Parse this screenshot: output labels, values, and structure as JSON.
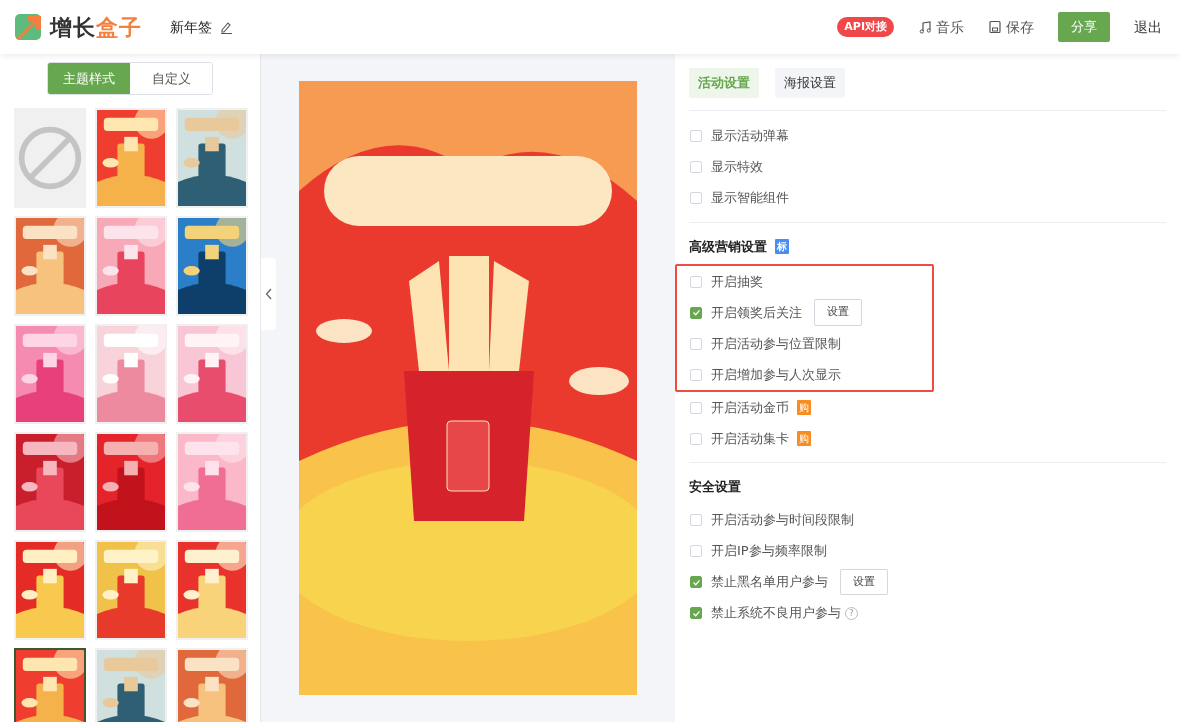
{
  "header": {
    "logo_parts": [
      "增长",
      "盒子"
    ],
    "title": "新年签",
    "api_badge": "API对接",
    "actions": [
      {
        "kind": "music",
        "label": "音乐"
      },
      {
        "kind": "save",
        "label": "保存"
      }
    ],
    "share": "分享",
    "exit": "退出"
  },
  "theme_tabs": [
    {
      "label": "主题样式",
      "selected": true
    },
    {
      "label": "自定义",
      "selected": false
    }
  ],
  "templates": [
    {
      "kind": "none",
      "selected": false
    },
    {
      "kind": "picture",
      "selected": false
    },
    {
      "kind": "picture",
      "selected": false
    },
    {
      "kind": "picture",
      "selected": false
    },
    {
      "kind": "picture",
      "selected": false
    },
    {
      "kind": "picture",
      "selected": false
    },
    {
      "kind": "picture",
      "selected": false
    },
    {
      "kind": "picture",
      "selected": false
    },
    {
      "kind": "picture",
      "selected": false
    },
    {
      "kind": "picture",
      "selected": false
    },
    {
      "kind": "picture",
      "selected": false
    },
    {
      "kind": "picture",
      "selected": false
    },
    {
      "kind": "picture",
      "selected": false
    },
    {
      "kind": "picture",
      "selected": false
    },
    {
      "kind": "picture",
      "selected": false
    },
    {
      "kind": "picture",
      "selected": true
    },
    {
      "kind": "picture",
      "selected": false
    },
    {
      "kind": "picture",
      "selected": false
    }
  ],
  "preview": {
    "kind": "picture"
  },
  "settings_tabs": [
    {
      "label": "活动设置",
      "selected": true
    },
    {
      "label": "海报设置",
      "selected": false
    }
  ],
  "sections": [
    {
      "items": [
        {
          "label": "显示活动弹幕",
          "checked": false
        },
        {
          "label": "显示特效",
          "checked": false
        },
        {
          "label": "显示智能组件",
          "checked": false
        }
      ]
    },
    {
      "title": "高级营销设置",
      "title_tag": "标",
      "items": [
        {
          "label": "开启抽奖",
          "checked": false,
          "highlighted": true
        },
        {
          "label": "开启领奖后关注",
          "checked": true,
          "button": "设置",
          "highlighted": true
        },
        {
          "label": "开启活动参与位置限制",
          "checked": false,
          "highlighted": true
        },
        {
          "label": "开启增加参与人次显示",
          "checked": false,
          "highlighted": true
        },
        {
          "label": "开启活动金币",
          "checked": false,
          "tag": "购"
        },
        {
          "label": "开启活动集卡",
          "checked": false,
          "tag": "购"
        }
      ]
    },
    {
      "title": "安全设置",
      "items": [
        {
          "label": "开启活动参与时间段限制",
          "checked": false
        },
        {
          "label": "开启IP参与频率限制",
          "checked": false
        },
        {
          "label": "禁止黑名单用户参与",
          "checked": true,
          "button": "设置"
        },
        {
          "label": "禁止系统不良用户参与",
          "checked": true,
          "help": "?"
        }
      ]
    }
  ]
}
